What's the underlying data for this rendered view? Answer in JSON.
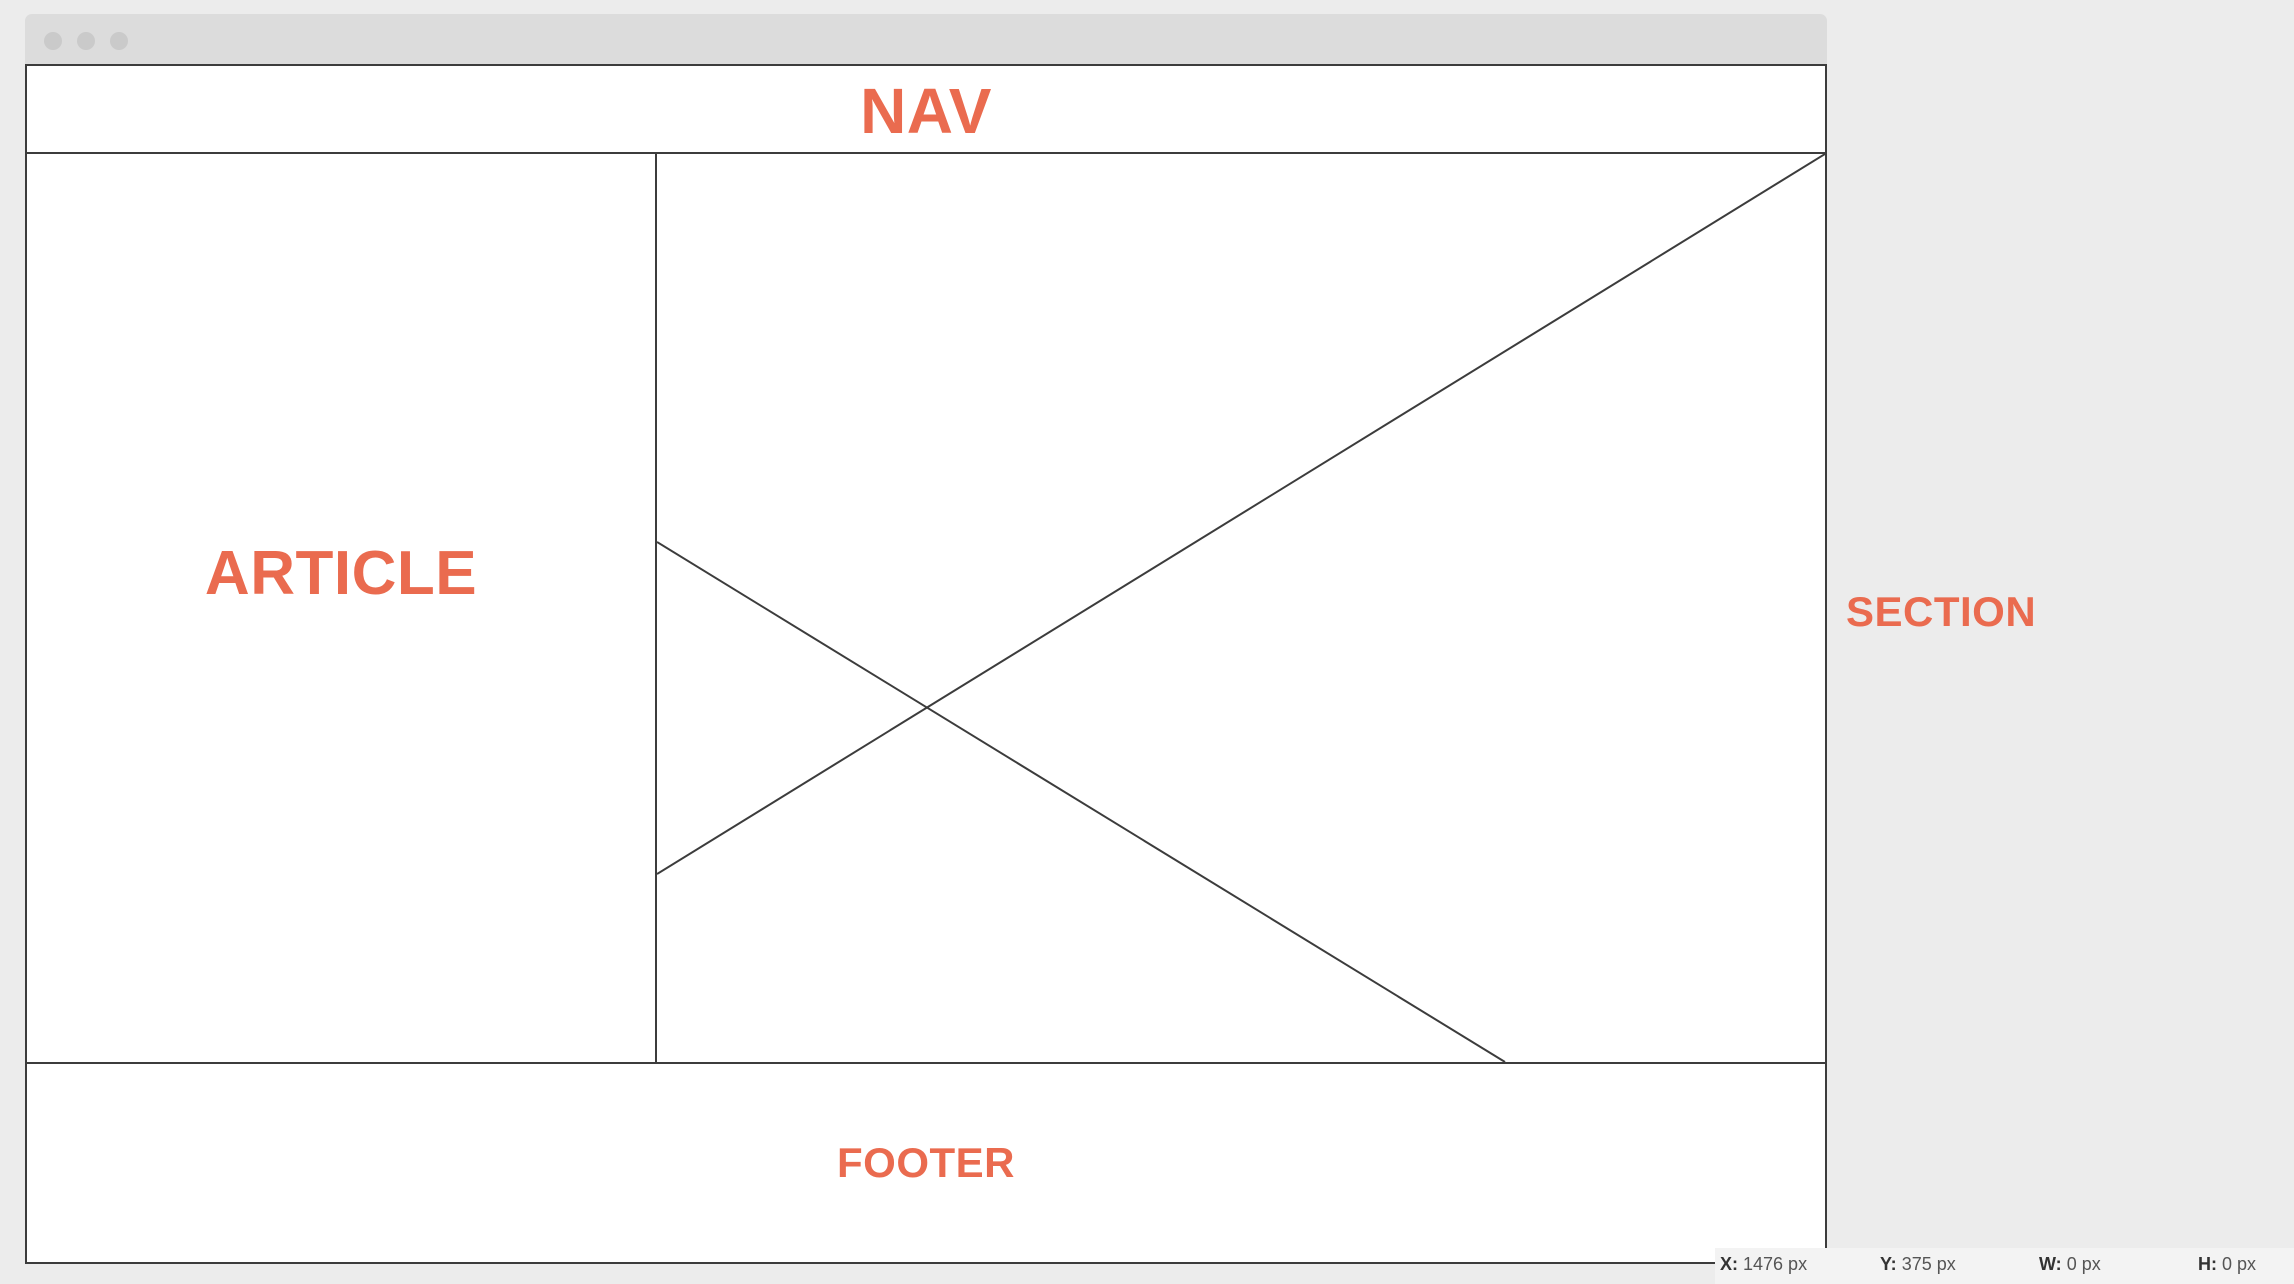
{
  "wireframe": {
    "nav_label": "NAV",
    "article_label": "ARTICLE",
    "footer_label": "FOOTER",
    "section_label": "SECTION"
  },
  "statusbar": {
    "x_label": "X:",
    "x_value": "1476 px",
    "y_label": "Y:",
    "y_value": "375 px",
    "w_label": "W:",
    "w_value": "0 px",
    "h_label": "H:",
    "h_value": "0 px"
  },
  "colors": {
    "label": "#ea6b4f",
    "border": "#3c3c3c",
    "background": "#ececec"
  }
}
